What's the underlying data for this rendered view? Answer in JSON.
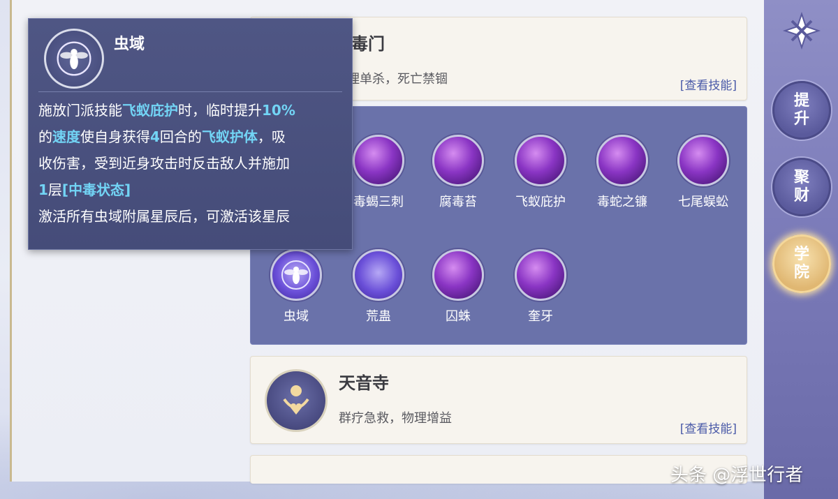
{
  "sect_top": {
    "title_partial": "万毒门",
    "desc_partial": "物理单杀，死亡禁锢",
    "link": "[查看技能]"
  },
  "skills": [
    {
      "name": "毒蝎三刺"
    },
    {
      "name": "腐毒苔"
    },
    {
      "name": "飞蚁庇护"
    },
    {
      "name": "毒蛇之镰"
    },
    {
      "name": "七尾蜈蚣"
    },
    {
      "name": "虫域"
    },
    {
      "name": "荒蛊"
    },
    {
      "name": "囚蛛"
    },
    {
      "name": "奎牙"
    }
  ],
  "sect_tianyin": {
    "title": "天音寺",
    "desc": "群疗急救，物理增益",
    "link": "[查看技能]"
  },
  "tooltip": {
    "title": "虫域",
    "line1_a": "施放门派技能",
    "line1_b": "飞蚁庇护",
    "line1_c": "时，临时提升",
    "line1_d": "10%",
    "line2_a": "的",
    "line2_b": "速度",
    "line2_c": "使自身获得",
    "line2_d": "4",
    "line2_e": "回合的",
    "line2_f": "飞蚁护体",
    "line2_g": "，吸",
    "line3": "收伤害，受到近身攻击时反击敌人并施加",
    "line4_a": "1",
    "line4_b": "层",
    "line4_c": "[中毒状态]",
    "line5": "激活所有虫域附属星辰后，可激活该星辰"
  },
  "sidebar": {
    "btn_upgrade": "提升",
    "btn_wealth": "聚财",
    "btn_academy": "学院"
  },
  "watermark": "头条 @浮世行者"
}
